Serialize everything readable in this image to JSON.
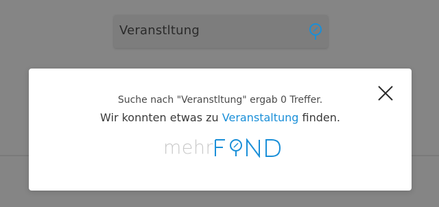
{
  "search": {
    "value": "Veranstltung",
    "icon": "search-pin-icon"
  },
  "modal": {
    "line1": "Suche nach \"Veranstltung\" ergab 0 Treffer.",
    "line2_prefix": "Wir konnten etwas zu ",
    "suggestion": "Veranstaltung",
    "line2_suffix": " finden.",
    "close_icon": "close-icon"
  },
  "brand": {
    "text_light": "mehr",
    "text_strong": "FIND"
  },
  "colors": {
    "accent": "#1a8fd8",
    "brand_grey": "#c8c8c8",
    "overlay": "#858585",
    "modal_bg": "#ffffff"
  }
}
